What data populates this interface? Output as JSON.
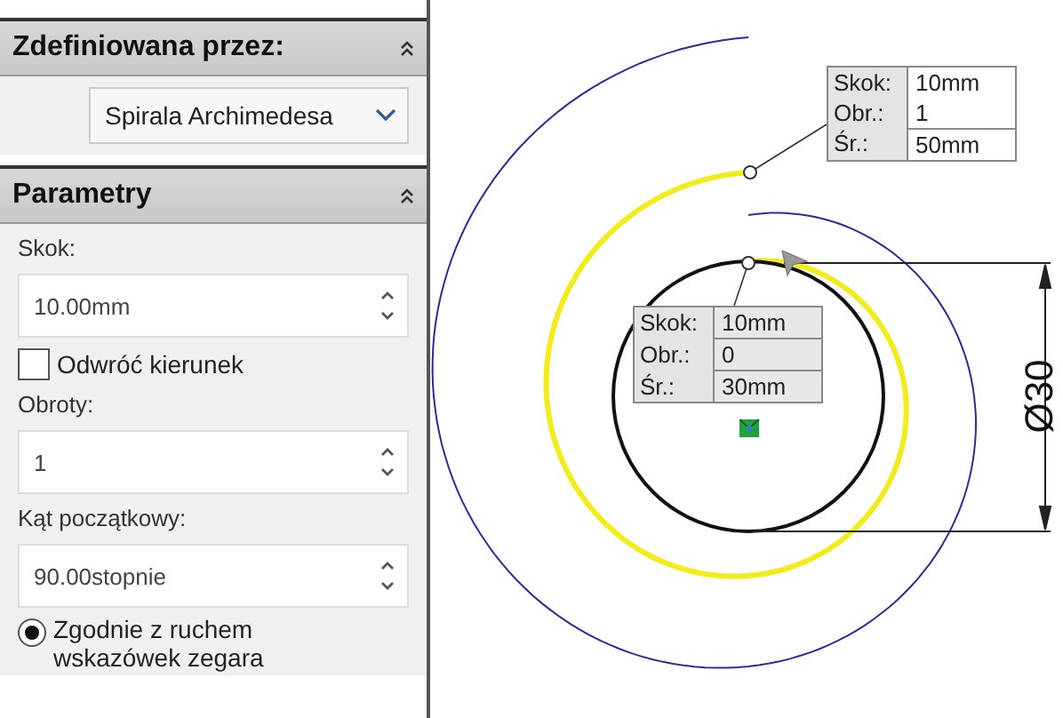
{
  "sections": [
    {
      "title": "Zdefiniowana przez:",
      "expanded": true,
      "controls": [
        {
          "kind": "dropdown",
          "value": "Spirala Archimedesa"
        }
      ]
    },
    {
      "title": "Parametry",
      "expanded": true,
      "controls": [
        {
          "kind": "label",
          "text": "Skok:"
        },
        {
          "kind": "spinner",
          "value": "10.00mm"
        },
        {
          "kind": "checkbox",
          "label": "Odwróć kierunek",
          "checked": false
        },
        {
          "kind": "label",
          "text": "Obroty:"
        },
        {
          "kind": "spinner",
          "value": "1"
        },
        {
          "kind": "label",
          "text": "Kąt początkowy:"
        },
        {
          "kind": "spinner",
          "value": "90.00stopnie"
        },
        {
          "kind": "radio",
          "label": "Zgodnie z ruchem wskazówek zegara",
          "selected": true
        }
      ]
    }
  ],
  "canvas": {
    "callouts": [
      {
        "rows": [
          {
            "label": "Skok:",
            "value": "10mm"
          },
          {
            "label": "Obr.:",
            "value": "1"
          },
          {
            "label": "Śr.:",
            "value": "50mm"
          }
        ]
      },
      {
        "rows": [
          {
            "label": "Skok:",
            "value": "10mm"
          },
          {
            "label": "Obr.:",
            "value": "0"
          },
          {
            "label": "Śr.:",
            "value": "30mm"
          }
        ]
      }
    ],
    "dimension": "Ø30"
  }
}
